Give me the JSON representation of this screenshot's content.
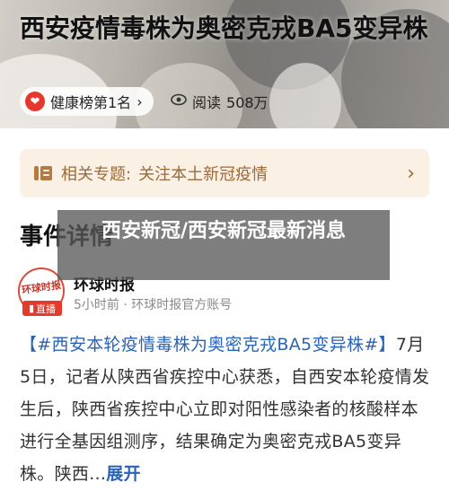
{
  "article": {
    "title": "西安疫情毒株为奥密克戎BA5变异株",
    "hot_list_label": "健康榜第1名",
    "hot_list_chevron": "›",
    "reads_label": "阅读",
    "reads_value": "508万"
  },
  "topic": {
    "prefix": "相关专题:",
    "name": "关注本土新冠疫情",
    "chevron": "›"
  },
  "section": {
    "heading": "事件详情"
  },
  "author": {
    "name": "环球时报",
    "logo_text": "环球时报",
    "meta": "5小时前 · 环球时报官方账号",
    "live_label": "直播"
  },
  "content": {
    "hashtag": "【#西安本轮疫情毒株为奥密克戎BA5变异株#】",
    "body": "7月5日，记者从陕西省疾控中心获悉，自西安本轮疫情发生后，陕西省疾控中心立即对阳性感染者的核酸样本进行全基因组测序，结果确定为奥密克戎BA5变异株。陕西...",
    "expand_label": "展开"
  },
  "overlay": {
    "text": "西安新冠/西安新冠最新消息"
  },
  "colors": {
    "accent_red": "#e23b2e",
    "link_blue": "#2a62b8",
    "topic_bg": "#fbf0e4",
    "topic_text": "#9b6a3a"
  },
  "icons": {
    "hot_badge": "heart-icon",
    "reads": "eye-icon",
    "topic": "document-icon",
    "topic_arrow": "chevron-right-icon"
  }
}
